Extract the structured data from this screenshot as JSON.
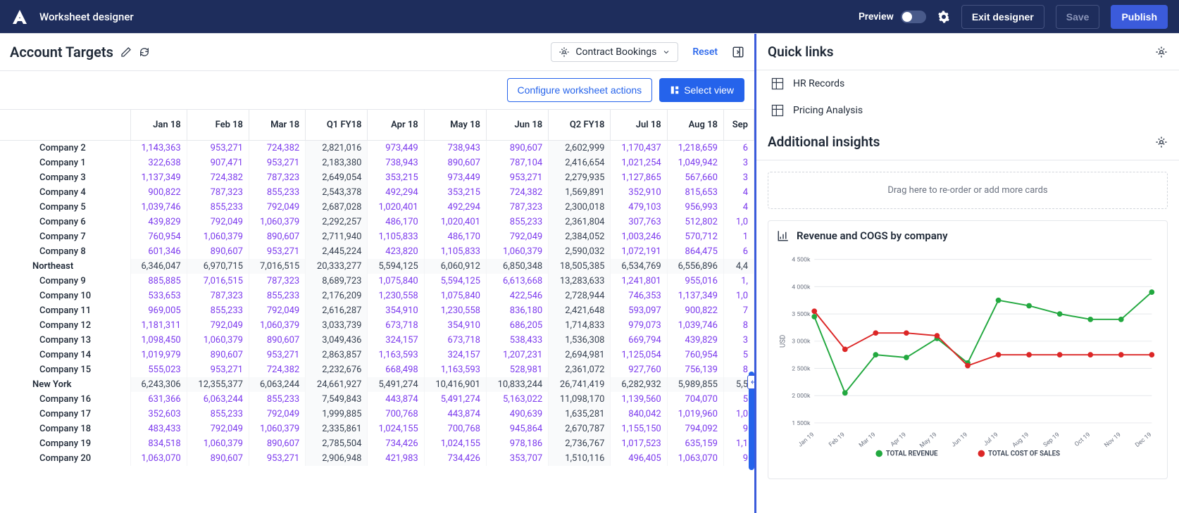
{
  "topbar": {
    "title": "Worksheet designer",
    "preview": "Preview",
    "exit": "Exit designer",
    "save": "Save",
    "publish": "Publish"
  },
  "page": {
    "title": "Account Targets",
    "dropdown": "Contract Bookings",
    "reset": "Reset",
    "configure": "Configure worksheet actions",
    "selectView": "Select view"
  },
  "columns": [
    "Jan 18",
    "Feb 18",
    "Mar 18",
    "Q1 FY18",
    "Apr 18",
    "May 18",
    "Jun 18",
    "Q2 FY18",
    "Jul 18",
    "Aug 18",
    "Sep"
  ],
  "colTypes": [
    "v",
    "v",
    "v",
    "c",
    "v",
    "v",
    "v",
    "c",
    "v",
    "v",
    "v"
  ],
  "rows": [
    {
      "label": "Company 2",
      "type": "item",
      "cells": [
        "1,143,363",
        "953,271",
        "724,382",
        "2,821,016",
        "973,449",
        "738,943",
        "890,607",
        "2,602,999",
        "1,170,437",
        "1,218,659",
        "6"
      ]
    },
    {
      "label": "Company 1",
      "type": "item",
      "cells": [
        "322,638",
        "907,471",
        "953,271",
        "2,183,380",
        "738,943",
        "890,607",
        "787,104",
        "2,416,654",
        "1,021,254",
        "1,049,942",
        "3"
      ]
    },
    {
      "label": "Company 3",
      "type": "item",
      "cells": [
        "1,137,349",
        "724,382",
        "787,323",
        "2,649,054",
        "353,215",
        "973,449",
        "953,271",
        "2,279,935",
        "1,127,865",
        "567,660",
        "3"
      ]
    },
    {
      "label": "Company 4",
      "type": "item",
      "cells": [
        "900,822",
        "787,323",
        "855,233",
        "2,543,378",
        "492,294",
        "353,215",
        "724,382",
        "1,569,891",
        "352,910",
        "815,653",
        "4"
      ]
    },
    {
      "label": "Company 5",
      "type": "item",
      "cells": [
        "1,039,746",
        "855,233",
        "792,049",
        "2,687,028",
        "1,020,401",
        "492,294",
        "787,323",
        "2,300,018",
        "479,103",
        "956,993",
        "4"
      ]
    },
    {
      "label": "Company 6",
      "type": "item",
      "cells": [
        "439,829",
        "792,049",
        "1,060,379",
        "2,292,257",
        "486,170",
        "1,020,401",
        "855,233",
        "2,361,804",
        "307,763",
        "512,802",
        "1,0"
      ]
    },
    {
      "label": "Company 7",
      "type": "item",
      "cells": [
        "760,954",
        "1,060,379",
        "890,607",
        "2,711,940",
        "1,105,833",
        "486,170",
        "792,049",
        "2,384,052",
        "1,003,246",
        "570,712",
        "1"
      ]
    },
    {
      "label": "Company 8",
      "type": "item",
      "cells": [
        "601,346",
        "890,607",
        "953,271",
        "2,445,224",
        "423,820",
        "1,105,833",
        "1,060,379",
        "2,590,032",
        "1,072,191",
        "864,475",
        "6"
      ]
    },
    {
      "label": "Northeast",
      "type": "group",
      "cells": [
        "6,346,047",
        "6,970,715",
        "7,016,515",
        "20,333,277",
        "5,594,125",
        "6,060,912",
        "6,850,348",
        "18,505,385",
        "6,534,769",
        "6,556,896",
        "4,4"
      ]
    },
    {
      "label": "Company 9",
      "type": "item",
      "cells": [
        "885,885",
        "7,016,515",
        "787,323",
        "8,689,723",
        "1,075,840",
        "5,594,125",
        "6,613,668",
        "13,283,633",
        "1,241,801",
        "955,016",
        "1,"
      ]
    },
    {
      "label": "Company 10",
      "type": "item",
      "cells": [
        "533,653",
        "787,323",
        "855,233",
        "2,176,209",
        "1,230,558",
        "1,075,840",
        "422,546",
        "2,728,944",
        "746,353",
        "1,137,349",
        "1,0"
      ]
    },
    {
      "label": "Company 11",
      "type": "item",
      "cells": [
        "969,005",
        "855,233",
        "792,049",
        "2,616,287",
        "354,910",
        "1,230,558",
        "836,180",
        "2,421,648",
        "593,097",
        "900,822",
        "7"
      ]
    },
    {
      "label": "Company 12",
      "type": "item",
      "cells": [
        "1,181,311",
        "792,049",
        "1,060,379",
        "3,033,739",
        "673,718",
        "354,910",
        "686,205",
        "1,714,833",
        "979,073",
        "1,039,746",
        "8"
      ]
    },
    {
      "label": "Company 13",
      "type": "item",
      "cells": [
        "1,098,450",
        "1,060,379",
        "890,607",
        "3,049,436",
        "324,157",
        "673,718",
        "538,433",
        "1,536,308",
        "669,794",
        "439,829",
        "3"
      ]
    },
    {
      "label": "Company 14",
      "type": "item",
      "cells": [
        "1,019,979",
        "890,607",
        "953,271",
        "2,863,857",
        "1,163,593",
        "324,157",
        "1,207,231",
        "2,694,981",
        "1,125,054",
        "760,954",
        "5"
      ]
    },
    {
      "label": "Company 15",
      "type": "item",
      "cells": [
        "555,023",
        "953,271",
        "724,382",
        "2,232,676",
        "668,498",
        "1,163,593",
        "528,981",
        "2,361,072",
        "927,760",
        "756,139",
        "8"
      ]
    },
    {
      "label": "New York",
      "type": "group",
      "cells": [
        "6,243,306",
        "12,355,377",
        "6,063,244",
        "24,661,927",
        "5,491,274",
        "10,416,901",
        "10,833,244",
        "26,741,419",
        "6,282,932",
        "5,989,855",
        "5,5"
      ]
    },
    {
      "label": "Company 16",
      "type": "item",
      "cells": [
        "631,366",
        "6,063,244",
        "855,233",
        "7,549,843",
        "443,874",
        "5,491,274",
        "5,163,022",
        "11,098,170",
        "1,139,560",
        "704,070",
        "5"
      ]
    },
    {
      "label": "Company 17",
      "type": "item",
      "cells": [
        "352,603",
        "855,233",
        "792,049",
        "1,999,885",
        "700,768",
        "443,874",
        "490,639",
        "1,635,281",
        "840,042",
        "1,019,960",
        "1,0"
      ]
    },
    {
      "label": "Company 18",
      "type": "item",
      "cells": [
        "483,433",
        "792,049",
        "1,060,379",
        "2,335,861",
        "1,024,155",
        "700,768",
        "945,864",
        "2,670,787",
        "1,155,150",
        "794,092",
        "9"
      ]
    },
    {
      "label": "Company 19",
      "type": "item",
      "cells": [
        "834,518",
        "1,060,379",
        "890,607",
        "2,785,504",
        "734,426",
        "1,024,155",
        "978,186",
        "2,736,767",
        "1,017,523",
        "635,159",
        "1,1"
      ]
    },
    {
      "label": "Company 20",
      "type": "item",
      "cells": [
        "1,063,070",
        "890,607",
        "953,271",
        "2,906,948",
        "421,983",
        "734,426",
        "353,707",
        "1,510,116",
        "496,405",
        "1,063,070",
        "9"
      ]
    }
  ],
  "sidebar": {
    "quickLinks": "Quick links",
    "links": [
      "HR Records",
      "Pricing Analysis"
    ],
    "insights": "Additional insights",
    "dropzone": "Drag here to re-order or add more cards",
    "cardTitle": "Revenue and COGS by company"
  },
  "chart_data": {
    "type": "line",
    "title": "Revenue and COGS by company",
    "ylabel": "USD",
    "ylim": [
      1500,
      4500
    ],
    "yticks": [
      "1 500k",
      "2 000k",
      "2 500k",
      "3 000k",
      "3 500k",
      "4 000k",
      "4 500k"
    ],
    "categories": [
      "Jan 19",
      "Feb 19",
      "Mar 19",
      "Apr 19",
      "May 19",
      "Jun 19",
      "Jul 19",
      "Aug 19",
      "Sep 19",
      "Oct 19",
      "Nov 19",
      "Dec 19"
    ],
    "series": [
      {
        "name": "TOTAL REVENUE",
        "color": "#22a83f",
        "values": [
          3450,
          2050,
          2750,
          2700,
          3050,
          2600,
          3750,
          3650,
          3500,
          3400,
          3400,
          3900
        ]
      },
      {
        "name": "TOTAL COST OF SALES",
        "color": "#dc2626",
        "values": [
          3550,
          2850,
          3150,
          3150,
          3100,
          2550,
          2750,
          2750,
          2750,
          2750,
          2750,
          2750
        ]
      }
    ]
  }
}
